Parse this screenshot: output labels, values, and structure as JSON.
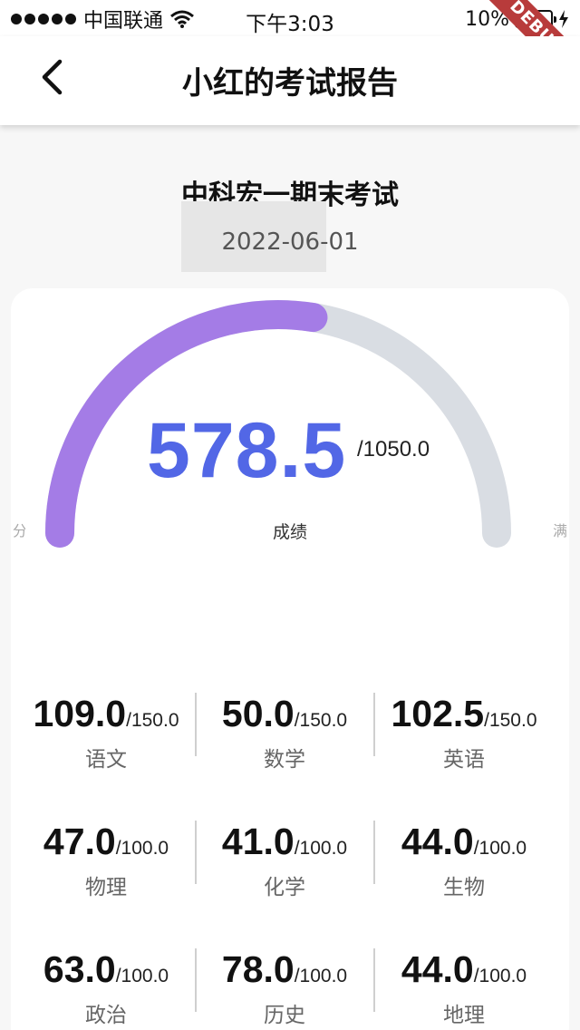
{
  "status_bar": {
    "carrier": "中国联通",
    "time": "下午3:03",
    "battery": "10%",
    "debug_label": "DEBUG"
  },
  "nav": {
    "title": "小红的考试报告"
  },
  "exam": {
    "name": "中科宏一期末考试",
    "date": "2022-06-01"
  },
  "gauge": {
    "score": "578.5",
    "total": "/1050.0",
    "label": "成绩",
    "fraction": 0.551,
    "fill_color": "#a47ce6",
    "track_color": "#d9dde3",
    "score_color": "#5267e6"
  },
  "subjects": [
    {
      "score": "109.0",
      "total": "/150.0",
      "name": "语文"
    },
    {
      "score": "50.0",
      "total": "/150.0",
      "name": "数学"
    },
    {
      "score": "102.5",
      "total": "/150.0",
      "name": "英语"
    },
    {
      "score": "47.0",
      "total": "/100.0",
      "name": "物理"
    },
    {
      "score": "41.0",
      "total": "/100.0",
      "name": "化学"
    },
    {
      "score": "44.0",
      "total": "/100.0",
      "name": "生物"
    },
    {
      "score": "63.0",
      "total": "/100.0",
      "name": "政治"
    },
    {
      "score": "78.0",
      "total": "/100.0",
      "name": "历史"
    },
    {
      "score": "44.0",
      "total": "/100.0",
      "name": "地理"
    }
  ],
  "icons": {
    "back": "chevron-left-icon",
    "wifi": "wifi-icon",
    "signal": "signal-icon",
    "battery": "battery-icon",
    "charging": "bolt-icon"
  }
}
